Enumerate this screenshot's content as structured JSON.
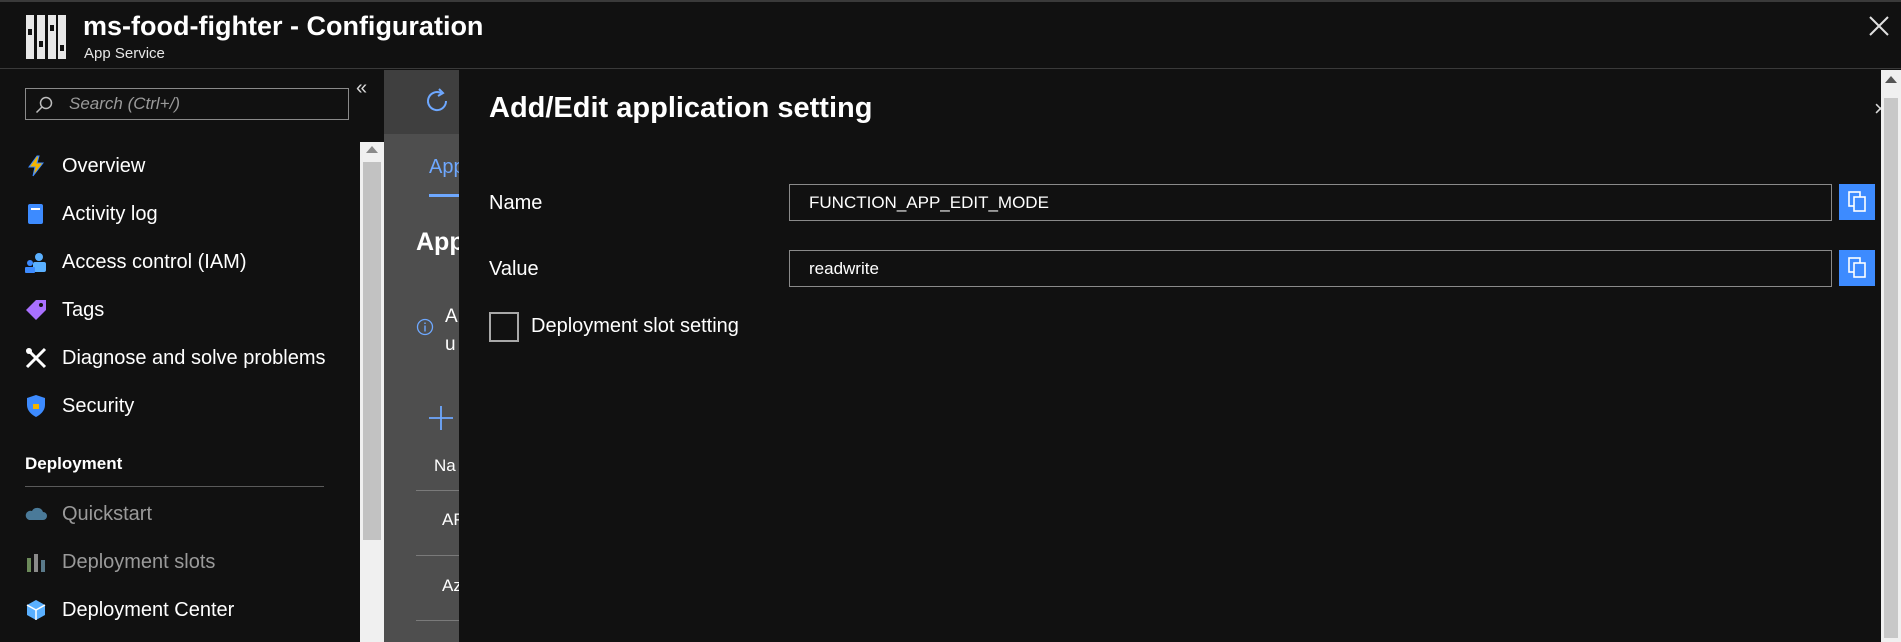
{
  "header": {
    "title": "ms-food-fighter - Configuration",
    "subtitle": "App Service",
    "logo_icon": "app-service-bars-icon",
    "close_icon": "close-icon"
  },
  "sidebar": {
    "search": {
      "placeholder": "Search (Ctrl+/)",
      "value": ""
    },
    "collapse_label": "«",
    "items": [
      {
        "label": "Overview",
        "icon": "lightning-icon",
        "enabled": true
      },
      {
        "label": "Activity log",
        "icon": "activity-log-icon",
        "enabled": true
      },
      {
        "label": "Access control (IAM)",
        "icon": "people-icon",
        "enabled": true
      },
      {
        "label": "Tags",
        "icon": "tag-icon",
        "enabled": true
      },
      {
        "label": "Diagnose and solve problems",
        "icon": "wrench-icon",
        "enabled": true
      },
      {
        "label": "Security",
        "icon": "shield-icon",
        "enabled": true
      }
    ],
    "section": "Deployment",
    "deployment_items": [
      {
        "label": "Quickstart",
        "icon": "cloud-icon",
        "enabled": false
      },
      {
        "label": "Deployment slots",
        "icon": "slots-icon",
        "enabled": false
      },
      {
        "label": "Deployment Center",
        "icon": "deployment-center-icon",
        "enabled": true
      }
    ]
  },
  "background_blade": {
    "tab": "App",
    "heading": "App",
    "info_line1": "A",
    "info_line2": "u",
    "column_header": "Na",
    "row1": "AP",
    "row2": "Az"
  },
  "dialog": {
    "title": "Add/Edit application setting",
    "name_label": "Name",
    "name_value": "FUNCTION_APP_EDIT_MODE",
    "value_label": "Value",
    "value_value": "readwrite",
    "checkbox_label": "Deployment slot setting",
    "checkbox_checked": false
  },
  "colors": {
    "background": "#111111",
    "accent": "#3d8bff",
    "link": "#6ea8ff"
  }
}
